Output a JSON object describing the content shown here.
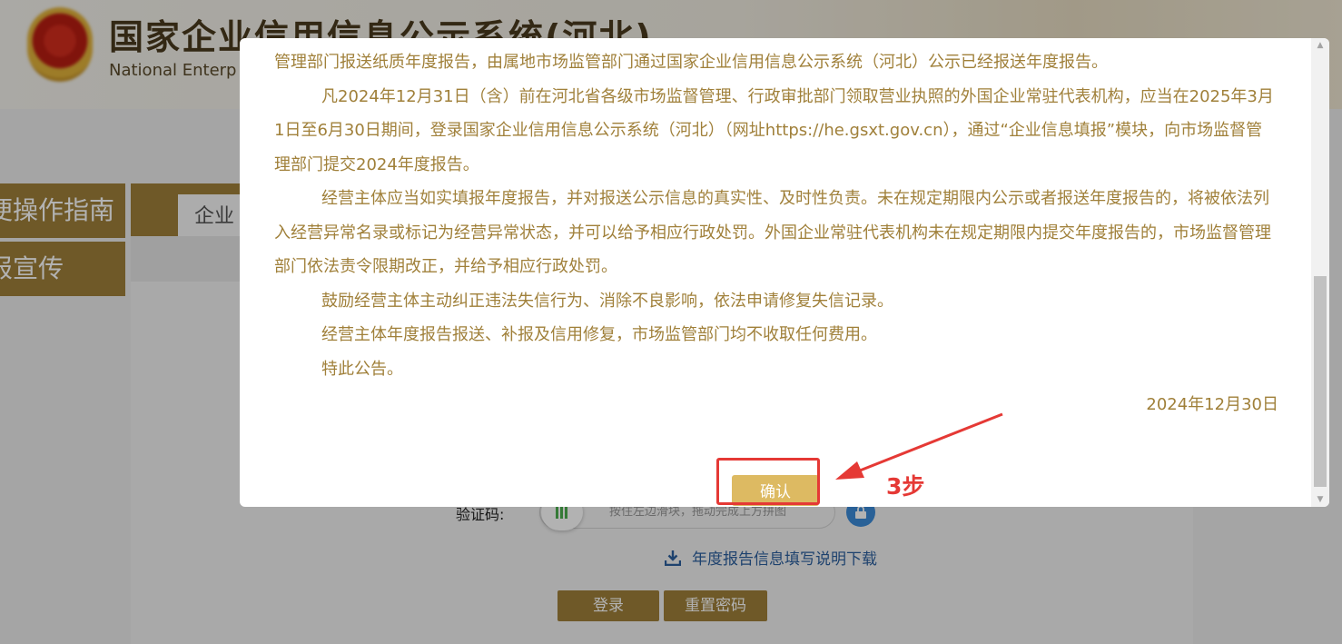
{
  "header": {
    "site_title": "国家企业信用信息公示系统(河北)",
    "site_subtitle": "National Enterp"
  },
  "sidebar": {
    "items": [
      {
        "label": "便操作指南"
      },
      {
        "label": "报宣传"
      }
    ]
  },
  "main": {
    "tab_label": "企业"
  },
  "login_form": {
    "captcha_label": "验证码:",
    "slider_hint": "按住左边滑块，拖动完成上方拼图",
    "download_link": "年度报告信息填写说明下载",
    "login_button": "登录",
    "reset_button": "重置密码"
  },
  "modal": {
    "paragraphs": [
      "管理部门报送纸质年度报告，由属地市场监管部门通过国家企业信用信息公示系统（河北）公示已经报送年度报告。",
      "凡2024年12月31日（含）前在河北省各级市场监督管理、行政审批部门领取营业执照的外国企业常驻代表机构，应当在2025年3月1日至6月30日期间，登录国家企业信用信息公示系统（河北）（网址https://he.gsxt.gov.cn），通过“企业信息填报”模块，向市场监督管理部门提交2024年度报告。",
      "经营主体应当如实填报年度报告，并对报送公示信息的真实性、及时性负责。未在规定期限内公示或者报送年度报告的，将被依法列入经营异常名录或标记为经营异常状态，并可以给予相应行政处罚。外国企业常驻代表机构未在规定期限内提交年度报告的，市场监督管理部门依法责令限期改正，并给予相应行政处罚。",
      "鼓励经营主体主动纠正违法失信行为、消除不良影响，依法申请修复失信记录。",
      "经营主体年度报告报送、补报及信用修复，市场监管部门均不收取任何费用。",
      "特此公告。"
    ],
    "date": "2024年12月30日",
    "confirm_button": "确认"
  },
  "annotation": {
    "step_label": "3步",
    "color": "#e53935"
  },
  "colors": {
    "brand_gold": "#a0803a",
    "confirm_gold": "#ddba62",
    "link_blue": "#2b5f9e"
  }
}
